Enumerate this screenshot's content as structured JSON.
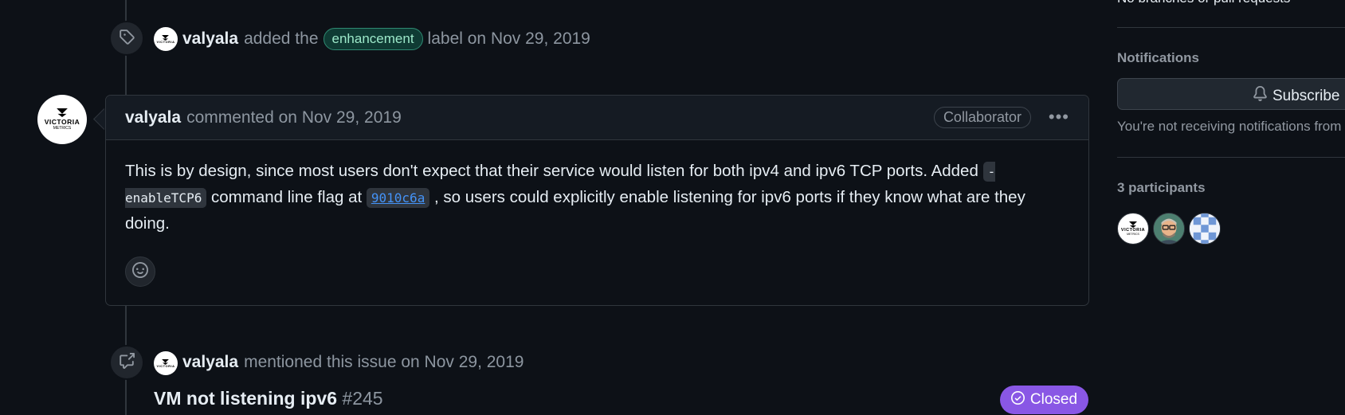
{
  "sidebar": {
    "branches_text": "No branches or pull requests",
    "notifications_heading": "Notifications",
    "subscribe_label": "Subscribe",
    "notifications_text": "You're not receiving notifications from this thread.",
    "participants_heading": "3 participants"
  },
  "label_event": {
    "user": "valyala",
    "text_before": "added the",
    "label": "enhancement",
    "text_after": "label on Nov 29, 2019"
  },
  "comment": {
    "user": "valyala",
    "meta": "commented on Nov 29, 2019",
    "role_badge": "Collaborator",
    "menu": "•••",
    "body_part1": "This is by design, since most users don't expect that their service would listen for both ipv4 and ipv6 TCP ports. Added",
    "flag_code": "-enableTCP6",
    "body_part2": "command line flag at",
    "commit_sha": "9010c6a",
    "body_part3": ", so users could explicitly enable listening for ipv6 ports if they know what are they doing."
  },
  "mention_event": {
    "user": "valyala",
    "text": "mentioned this issue on Nov 29, 2019",
    "issue_title": "VM not listening ipv6",
    "issue_number": "#245",
    "status": "Closed"
  },
  "avatar_logo": {
    "brand": "VICTORIA",
    "sub": "METRICS"
  },
  "colors": {
    "background": "#0d1117",
    "border": "#30363d",
    "muted": "#8d96a0",
    "link": "#4493f8",
    "closed_purple": "#8957e5",
    "label_green": "#2f8a72"
  },
  "icons": {
    "label_event": "tag-icon",
    "mention_event": "cross-reference-icon",
    "reaction": "smiley-icon",
    "subscribe": "bell-icon",
    "closed": "check-circle-icon"
  }
}
